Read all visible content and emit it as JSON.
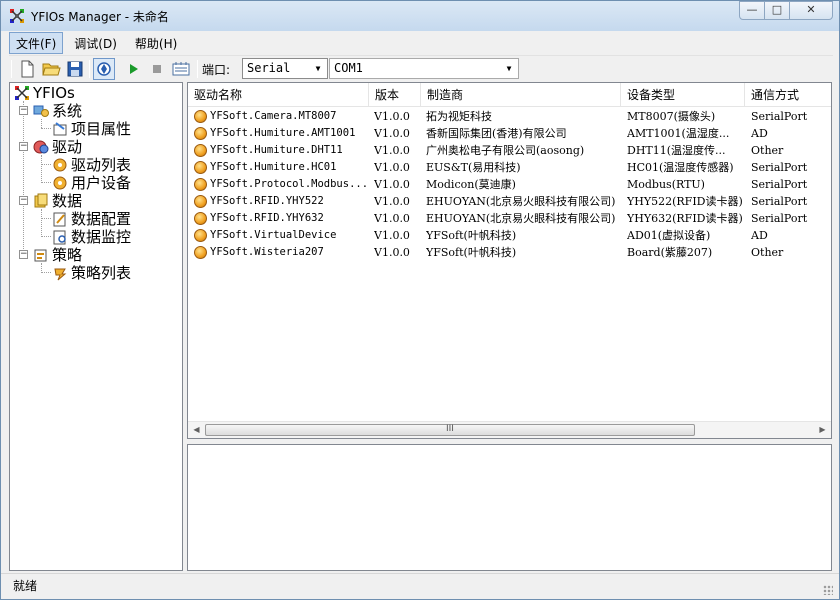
{
  "window": {
    "title": "YFIOs Manager - 未命名",
    "controls": {
      "minimize": "—",
      "maximize": "□",
      "close": "✕"
    }
  },
  "menu": [
    {
      "label": "文件(F)",
      "active": true
    },
    {
      "label": "调试(D)",
      "active": false
    },
    {
      "label": "帮助(H)",
      "active": false
    }
  ],
  "toolbar": {
    "port_label": "端口:",
    "port_value": "Serial",
    "com_value": "COM1",
    "icons": [
      "new-file-icon",
      "open-folder-icon",
      "save-icon",
      "connect-icon",
      "run-icon",
      "stop-icon",
      "monitor-icon"
    ]
  },
  "tree": {
    "root": "YFIOs",
    "groups": [
      {
        "label": "系统",
        "children": [
          "项目属性"
        ]
      },
      {
        "label": "驱动",
        "children": [
          "驱动列表",
          "用户设备"
        ]
      },
      {
        "label": "数据",
        "children": [
          "数据配置",
          "数据监控"
        ]
      },
      {
        "label": "策略",
        "children": [
          "策略列表"
        ]
      }
    ]
  },
  "list": {
    "columns": [
      "驱动名称",
      "版本",
      "制造商",
      "设备类型",
      "通信方式"
    ],
    "rows": [
      [
        "YFSoft.Camera.MT8007",
        "V1.0.0",
        "拓为视矩科技",
        "MT8007(摄像头)",
        "SerialPort"
      ],
      [
        "YFSoft.Humiture.AMT1001",
        "V1.0.0",
        "香新国际集团(香港)有限公司",
        "AMT1001(温湿度...",
        "AD"
      ],
      [
        "YFSoft.Humiture.DHT11",
        "V1.0.0",
        "广州奥松电子有限公司(aosong)",
        "DHT11(温湿度传...",
        "Other"
      ],
      [
        "YFSoft.Humiture.HC01",
        "V1.0.0",
        "EUS&T(易用科技)",
        "HC01(温湿度传感器)",
        "SerialPort"
      ],
      [
        "YFSoft.Protocol.Modbus...",
        "V1.0.0",
        "Modicon(莫迪康)",
        "Modbus(RTU)",
        "SerialPort"
      ],
      [
        "YFSoft.RFID.YHY522",
        "V1.0.0",
        "EHUOYAN(北京易火眼科技有限公司)",
        "YHY522(RFID读卡器)",
        "SerialPort"
      ],
      [
        "YFSoft.RFID.YHY632",
        "V1.0.0",
        "EHUOYAN(北京易火眼科技有限公司)",
        "YHY632(RFID读卡器)",
        "SerialPort"
      ],
      [
        "YFSoft.VirtualDevice",
        "V1.0.0",
        "YFSoft(叶帆科技)",
        "AD01(虚拟设备)",
        "AD"
      ],
      [
        "YFSoft.Wisteria207",
        "V1.0.0",
        "YFSoft(叶帆科技)",
        "Board(紫藤207)",
        "Other"
      ]
    ],
    "scroll_grip": "III"
  },
  "status": {
    "text": "就绪"
  }
}
